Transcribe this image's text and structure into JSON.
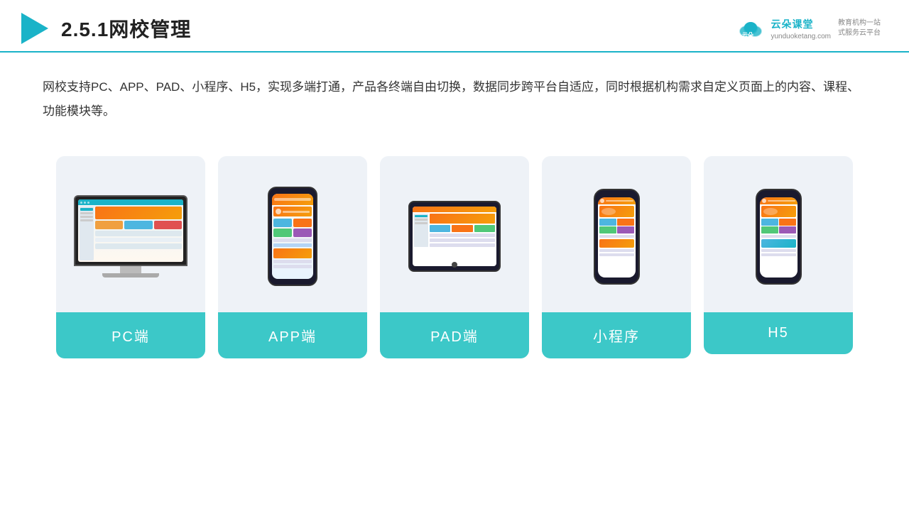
{
  "header": {
    "title": "2.5.1网校管理",
    "title_num": "2.5.1",
    "title_main": "网校管理",
    "brand_name": "云朵课堂",
    "brand_url": "yunduoketang.com",
    "brand_slogan": "教育机构一站\n式服务云平台"
  },
  "description": {
    "text": "网校支持PC、APP、PAD、小程序、H5，实现多端打通，产品各终端自由切换，数据同步跨平台自适应，同时根据机构需求自定义页面上的内容、课程、功能模块等。"
  },
  "cards": [
    {
      "id": "pc",
      "label": "PC端"
    },
    {
      "id": "app",
      "label": "APP端"
    },
    {
      "id": "pad",
      "label": "PAD端"
    },
    {
      "id": "miniprogram",
      "label": "小程序"
    },
    {
      "id": "h5",
      "label": "H5"
    }
  ],
  "colors": {
    "accent": "#1ab3c8",
    "card_label_bg": "#3cc8c8",
    "card_bg": "#eef2f7"
  }
}
